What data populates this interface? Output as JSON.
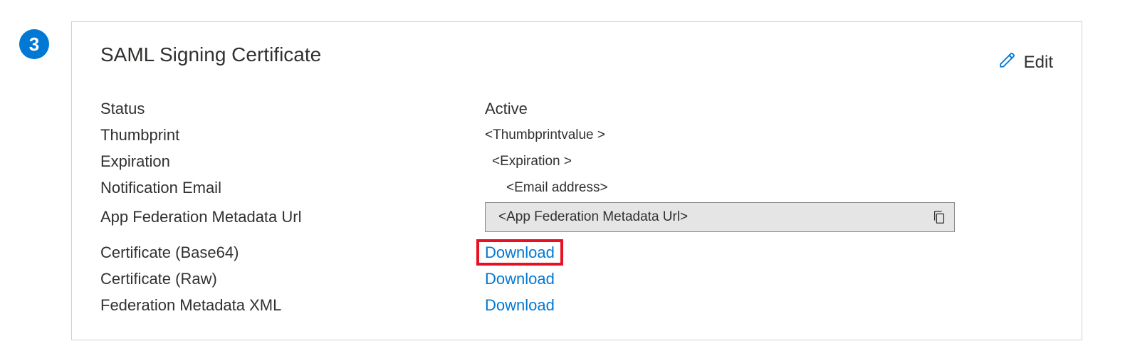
{
  "step_number": "3",
  "card": {
    "title": "SAML Signing Certificate",
    "edit_label": "Edit"
  },
  "fields": {
    "status": {
      "label": "Status",
      "value": "Active"
    },
    "thumbprint": {
      "label": "Thumbprint",
      "value": "<Thumbprintvalue >"
    },
    "expiration": {
      "label": "Expiration",
      "value": "<Expiration >"
    },
    "notification_email": {
      "label": "Notification Email",
      "value": "<Email address>"
    },
    "metadata_url": {
      "label": "App Federation Metadata Url",
      "value": "<App Federation Metadata Url>"
    },
    "cert_base64": {
      "label": "Certificate (Base64)",
      "link": "Download"
    },
    "cert_raw": {
      "label": "Certificate (Raw)",
      "link": "Download"
    },
    "fed_xml": {
      "label": "Federation Metadata XML",
      "link": "Download"
    }
  }
}
